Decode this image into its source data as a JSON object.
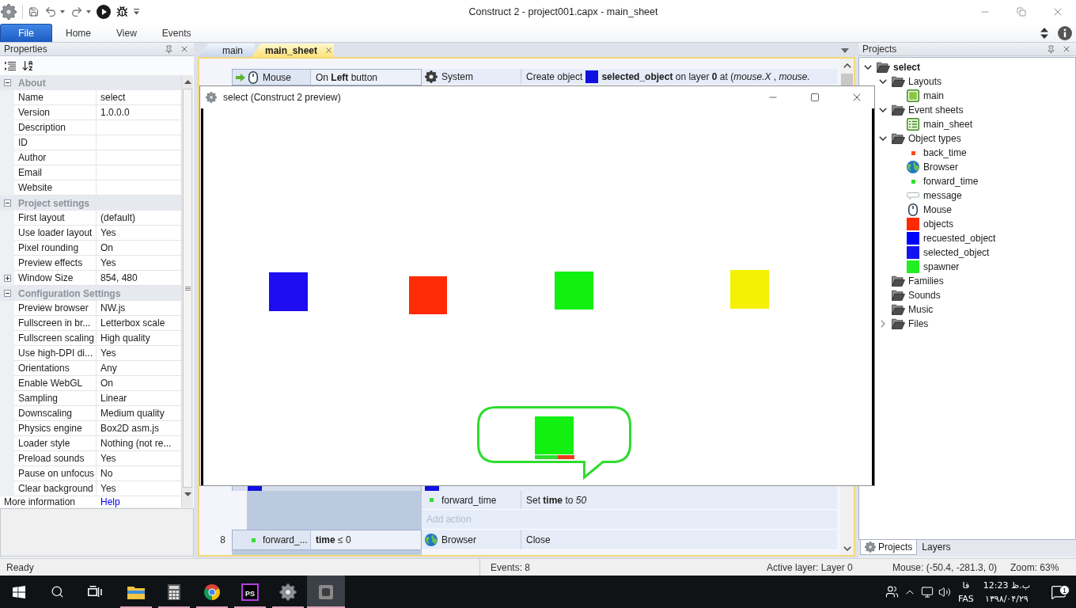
{
  "title_bar": {
    "title": "Construct 2 - project001.capx - main_sheet"
  },
  "ribbon": {
    "file_button": "File",
    "tabs": [
      {
        "label": "Home",
        "selected": false
      },
      {
        "label": "View",
        "selected": false
      },
      {
        "label": "Events",
        "selected": false
      }
    ]
  },
  "properties_panel": {
    "title": "Properties",
    "categories": [
      {
        "name": "About",
        "expanded": true,
        "rows": [
          {
            "kind": "plain",
            "name": "Name",
            "value": "select"
          },
          {
            "kind": "plain",
            "name": "Version",
            "value": "1.0.0.0"
          },
          {
            "kind": "plain",
            "name": "Description"
          },
          {
            "kind": "plain",
            "name": "ID"
          },
          {
            "kind": "plain",
            "name": "Author"
          },
          {
            "kind": "plain",
            "name": "Email"
          },
          {
            "kind": "plain",
            "name": "Website"
          }
        ]
      },
      {
        "name": "Project settings",
        "expanded": true,
        "rows": [
          {
            "kind": "plain",
            "name": "First layout",
            "value": "(default)"
          },
          {
            "kind": "plain",
            "name": "Use loader layout",
            "value": "Yes"
          },
          {
            "kind": "plain",
            "name": "Pixel rounding",
            "value": "On"
          },
          {
            "kind": "plain",
            "name": "Preview effects",
            "value": "Yes"
          },
          {
            "kind": "group",
            "expanded": false,
            "name": "Window Size",
            "value": "854, 480"
          }
        ]
      },
      {
        "name": "Configuration Settings",
        "expanded": true,
        "rows": [
          {
            "kind": "plain",
            "name": "Preview browser",
            "value": "NW.js"
          },
          {
            "kind": "plain",
            "name": "Fullscreen in br...",
            "value": "Letterbox scale"
          },
          {
            "kind": "plain",
            "name": "Fullscreen scaling",
            "value": "High quality"
          },
          {
            "kind": "plain",
            "name": "Use high-DPI di...",
            "value": "Yes"
          },
          {
            "kind": "plain",
            "name": "Orientations",
            "value": "Any"
          },
          {
            "kind": "plain",
            "name": "Enable WebGL",
            "value": "On"
          },
          {
            "kind": "plain",
            "name": "Sampling",
            "value": "Linear"
          },
          {
            "kind": "plain",
            "name": "Downscaling",
            "value": "Medium quality"
          },
          {
            "kind": "plain",
            "name": "Physics engine",
            "value": "Box2D asm.js"
          },
          {
            "kind": "plain",
            "name": "Loader style",
            "value": "Nothing (not re..."
          },
          {
            "kind": "plain",
            "name": "Preload sounds",
            "value": "Yes"
          },
          {
            "kind": "plain",
            "name": "Pause on unfocus",
            "value": "No"
          },
          {
            "kind": "plain",
            "name": "Clear background",
            "value": "Yes"
          }
        ]
      }
    ],
    "footer": {
      "label": "More information",
      "link": "Help"
    }
  },
  "document_tabs": [
    {
      "label": "main",
      "selected": false
    },
    {
      "label": "main_sheet",
      "selected": true
    }
  ],
  "event_sheet": {
    "top_event": {
      "conditions": [
        {
          "trigger": true,
          "kind": "mouse",
          "object": "Mouse",
          "text": "On **Left** button"
        }
      ],
      "actions": [
        {
          "kind": "gear",
          "object": "System",
          "text": "Create object",
          "target": {
            "color": "#1010e0"
          },
          "text_after": "**selected_object** on layer **0** at (*mouse.X* , *mouse.*"
        }
      ]
    },
    "cut_event": {
      "conditions": [
        {
          "kind": "swatch",
          "color": "#1010e0"
        }
      ],
      "actions": [
        {
          "kind": "swatch",
          "color": "#1010e0"
        }
      ]
    },
    "cut_event_actions": [
      {
        "kind": "dot",
        "color": "#33dd33",
        "object": "forward_time",
        "text": "Set **time** to *50*"
      }
    ],
    "add_action": "Add action",
    "bottom_event": {
      "number": "8",
      "conditions": [
        {
          "trigger": false,
          "kind": "dot",
          "color": "#33dd33",
          "object": "forward_...",
          "text": "**time** ≤ 0"
        }
      ],
      "actions": [
        {
          "kind": "globe",
          "object": "Browser",
          "text": "Close"
        }
      ]
    }
  },
  "preview_window": {
    "title": "select (Construct 2 preview)"
  },
  "projects_panel": {
    "title": "Projects",
    "tree": [
      {
        "label": "select",
        "kind": "folder",
        "expanded": true,
        "children": [
          {
            "label": "Layouts",
            "kind": "folder",
            "expanded": true,
            "children": [
              {
                "label": "main",
                "kind": "layout"
              }
            ]
          },
          {
            "label": "Event sheets",
            "kind": "folder",
            "expanded": true,
            "children": [
              {
                "label": "main_sheet",
                "kind": "sheet"
              }
            ]
          },
          {
            "label": "Object types",
            "kind": "folder",
            "expanded": true,
            "children": [
              {
                "label": "back_time",
                "kind": "dot",
                "color": "#ff4a1a"
              },
              {
                "label": "Browser",
                "kind": "globe"
              },
              {
                "label": "forward_time",
                "kind": "dot",
                "color": "#33dd33"
              },
              {
                "label": "message",
                "kind": "bubble"
              },
              {
                "label": "Mouse",
                "kind": "mouse"
              },
              {
                "label": "objects",
                "kind": "swatch",
                "color": "#ff2a00"
              },
              {
                "label": "recuested_object",
                "kind": "swatch",
                "color": "#0000ff"
              },
              {
                "label": "selected_object",
                "kind": "swatch",
                "color": "#1414f0"
              },
              {
                "label": "spawner",
                "kind": "swatch",
                "color": "#22ee22"
              }
            ]
          },
          {
            "label": "Families",
            "kind": "empty_folder"
          },
          {
            "label": "Sounds",
            "kind": "empty_folder"
          },
          {
            "label": "Music",
            "kind": "empty_folder"
          },
          {
            "label": "Files",
            "kind": "folder",
            "expanded": false
          }
        ]
      }
    ],
    "tabs": [
      {
        "label": "Projects",
        "kind": "projects",
        "selected": true
      },
      {
        "label": "Layers",
        "kind": "layers",
        "selected": false
      }
    ]
  },
  "status_bar": {
    "status": "Ready",
    "events": "Events: 8",
    "active_layer": "Active layer: Layer 0",
    "mouse": "Mouse: (-50.4, -281.3, 0)",
    "zoom": "Zoom: 63%"
  },
  "taskbar": {
    "apps": [
      {
        "kind": "explorer",
        "selected": false
      },
      {
        "kind": "calculator",
        "selected": false
      },
      {
        "kind": "browser",
        "selected": false
      },
      {
        "kind": "ide",
        "label": "PS",
        "selected": false
      },
      {
        "kind": "gear",
        "selected": false
      },
      {
        "kind": "preview",
        "selected": true
      }
    ],
    "language_short": "فا",
    "language": "FAS",
    "time": "12:23 ب.ظ",
    "date": "۱۳۹۸/۰۴/۲۹",
    "notifications": "1"
  }
}
